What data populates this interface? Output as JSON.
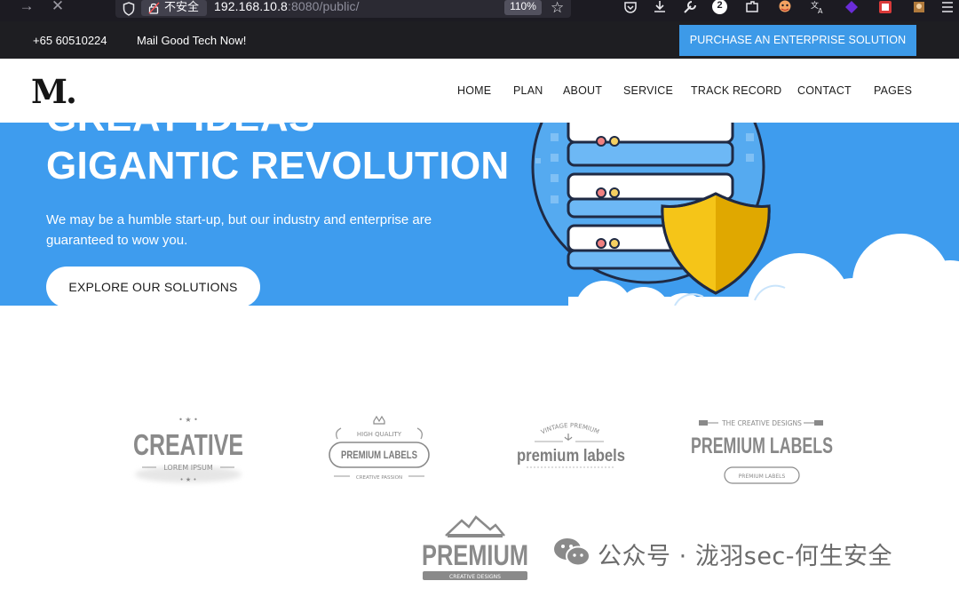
{
  "browser": {
    "insecure_label": "不安全",
    "url_host": "192.168.10.8",
    "url_rest": ":8080/public/",
    "zoom": "110%",
    "notification_count": "2"
  },
  "topbar": {
    "phone": "+65 60510224",
    "mail": "Mail Good Tech Now!",
    "cta": "PURCHASE AN ENTERPRISE SOLUTION"
  },
  "header": {
    "logo": "M.",
    "nav": [
      "HOME",
      "PLAN",
      "ABOUT",
      "SERVICE",
      "TRACK RECORD",
      "CONTACT",
      "PAGES"
    ]
  },
  "hero": {
    "title_cut": "GREAT IDEAS",
    "title": "GIGANTIC REVOLUTION",
    "subtitle": "We may be a humble start-up, but our industry and enterprise are guaranteed to wow you.",
    "button": "EXPLORE OUR SOLUTIONS"
  },
  "badges": {
    "creative": {
      "title": "CREATIVE",
      "sub": "LOREM IPSUM"
    },
    "high_quality": {
      "top": "HIGH QUALITY",
      "title": "PREMIUM LABELS",
      "bottom": "CREATIVE PASSION"
    },
    "vintage": {
      "top": "VINTAGE PREMIUM",
      "title": "premium labels"
    },
    "creative_designs": {
      "top": "THE CREATIVE DESIGNS",
      "title": "PREMIUM LABELS",
      "bottom": "PREMIUM LABELS"
    },
    "premium": {
      "title": "PREMIUM",
      "bottom": "CREATIVE DESIGNS"
    }
  },
  "watermark": "公众号 · 泷羽sec-何生安全",
  "colors": {
    "hero_blue": "#3e9cee",
    "cta_blue": "#3d9ae8",
    "topbar_dark": "#1e1e22",
    "shield_yellow": "#f5c518",
    "badge_gray": "#8a8a8a"
  }
}
